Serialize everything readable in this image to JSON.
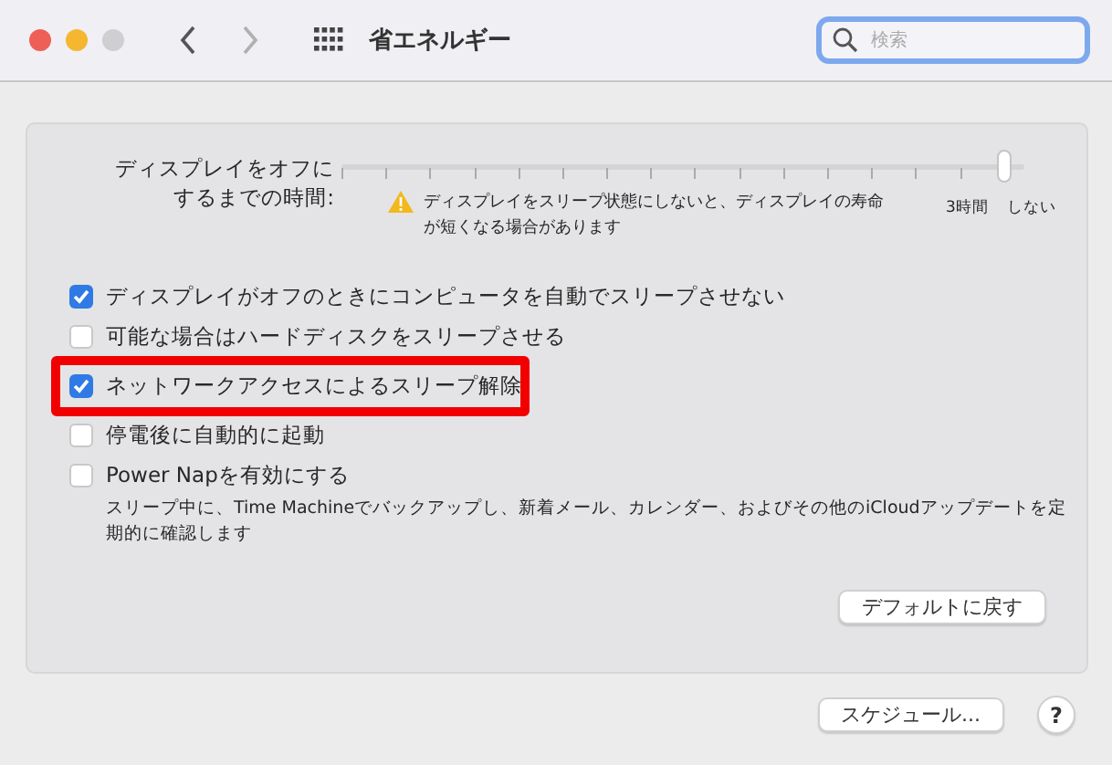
{
  "window": {
    "title": "省エネルギー"
  },
  "search": {
    "placeholder": "検索"
  },
  "display_sleep": {
    "label_lines": [
      "ディスプレイをオフに",
      "するまでの時間:"
    ],
    "level": 1,
    "tick_labels": [
      "3時間",
      "しない"
    ],
    "warning_lines": [
      "ディスプレイをスリープ状態にしないと、ディスプレイの寿命",
      "が短くなる場合があります"
    ]
  },
  "options": [
    {
      "label": "ディスプレイがオフのときにコンピュータを自動でスリープさせない",
      "checked": true
    },
    {
      "label": "可能な場合はハードディスクをスリープさせる",
      "checked": false
    },
    {
      "label": "ネットワークアクセスによるスリープ解除",
      "checked": true,
      "highlighted": true
    },
    {
      "label": "停電後に自動的に起動",
      "checked": false
    },
    {
      "label": "Power Napを有効にする",
      "checked": false,
      "description": "スリープ中に、Time Machineでバックアップし、新着メール、カレンダー、およびその他のiCloudアップデートを定期的に確認します"
    }
  ],
  "buttons": {
    "restore_defaults": "デフォルトに戻す",
    "schedule": "スケジュール...",
    "help": "?"
  }
}
